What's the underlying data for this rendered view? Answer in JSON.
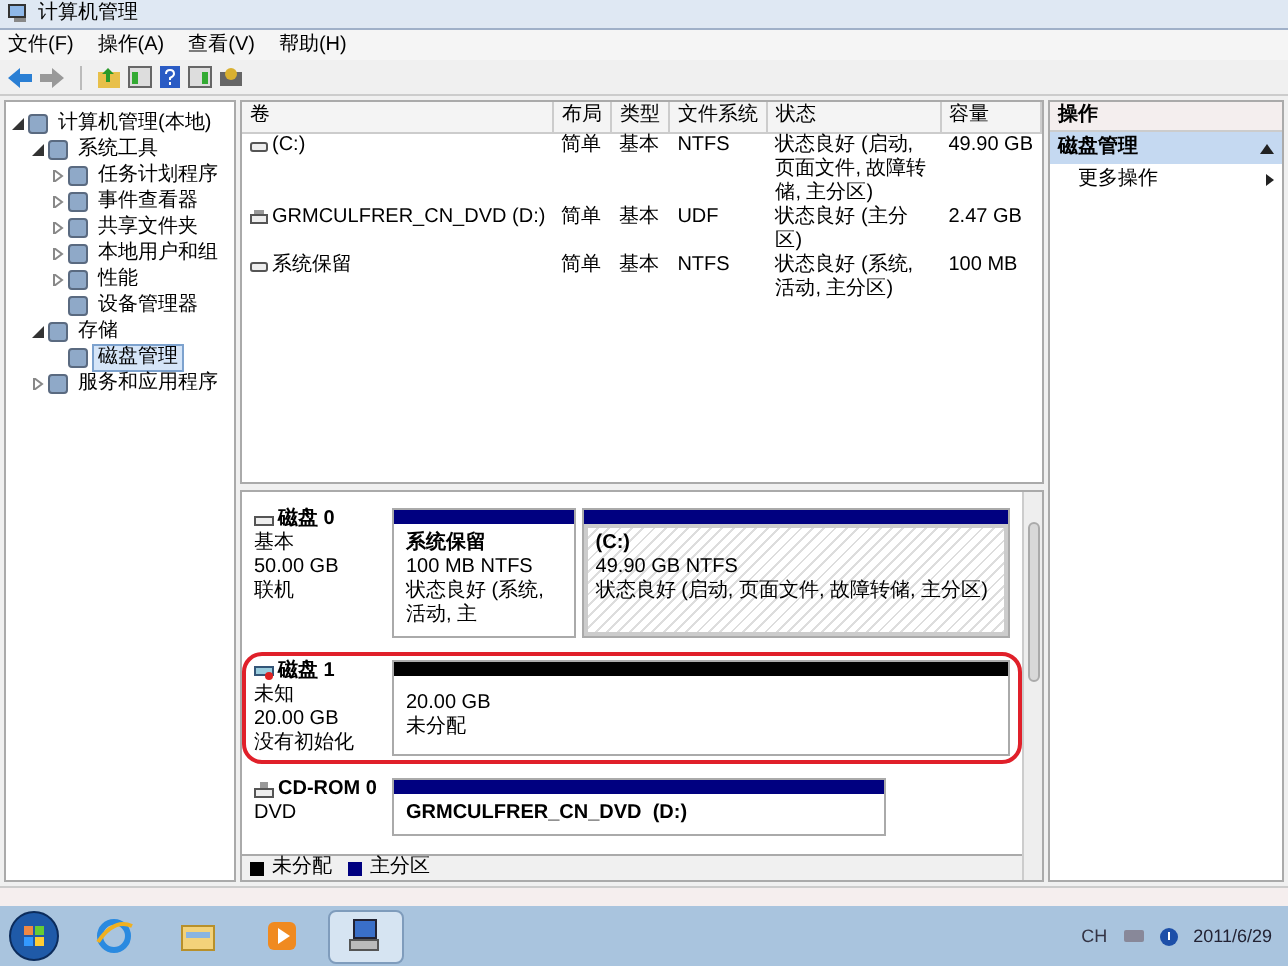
{
  "window": {
    "title": "计算机管理"
  },
  "menu": [
    "文件(F)",
    "操作(A)",
    "查看(V)",
    "帮助(H)"
  ],
  "tree": [
    {
      "label": "计算机管理(本地)",
      "selected": false,
      "expanded": true,
      "children": [
        {
          "label": "系统工具",
          "selected": false,
          "expanded": true,
          "children": [
            {
              "label": "任务计划程序",
              "selected": false,
              "expanded": false
            },
            {
              "label": "事件查看器",
              "selected": false,
              "expanded": false
            },
            {
              "label": "共享文件夹",
              "selected": false,
              "expanded": false
            },
            {
              "label": "本地用户和组",
              "selected": false,
              "expanded": false
            },
            {
              "label": "性能",
              "selected": false,
              "expanded": false
            },
            {
              "label": "设备管理器",
              "selected": false
            }
          ]
        },
        {
          "label": "存储",
          "selected": false,
          "expanded": true,
          "children": [
            {
              "label": "磁盘管理",
              "selected": true
            }
          ]
        },
        {
          "label": "服务和应用程序",
          "selected": false,
          "expanded": false
        }
      ]
    }
  ],
  "volumes": {
    "columns": [
      "卷",
      "布局",
      "类型",
      "文件系统",
      "状态",
      "容量"
    ],
    "rows": [
      {
        "kind": "disk",
        "cells": [
          "(C:)",
          "简单",
          "基本",
          "NTFS",
          "状态良好 (启动, 页面文件, 故障转储, 主分区)",
          "49.90 GB"
        ]
      },
      {
        "kind": "cdrom",
        "cells": [
          "GRMCULFRER_CN_DVD (D:)",
          "简单",
          "基本",
          "UDF",
          "状态良好 (主分区)",
          "2.47 GB"
        ]
      },
      {
        "kind": "disk",
        "cells": [
          "系统保留",
          "简单",
          "基本",
          "NTFS",
          "状态良好 (系统, 活动, 主分区)",
          "100 MB"
        ]
      }
    ]
  },
  "disks": [
    {
      "kind": "disk",
      "name": "磁盘 0",
      "lines": [
        "基本",
        "50.00 GB",
        "联机"
      ],
      "highlighted": false,
      "partitions": [
        {
          "kind": "primary",
          "selected": false,
          "title": "系统保留",
          "lines": [
            "100 MB NTFS",
            "状态良好 (系统, 活动, 主"
          ]
        },
        {
          "kind": "primary",
          "selected": true,
          "title": "(C:)",
          "lines": [
            "49.90 GB NTFS",
            "状态良好 (启动, 页面文件, 故障转储, 主分区)"
          ]
        }
      ]
    },
    {
      "kind": "unknown",
      "name": "磁盘 1",
      "lines": [
        "未知",
        "20.00 GB",
        "没有初始化"
      ],
      "highlighted": true,
      "partitions": [
        {
          "kind": "unallocated",
          "selected": false,
          "lines": [
            "20.00 GB",
            "未分配"
          ]
        }
      ]
    },
    {
      "kind": "cdrom",
      "name": "CD-ROM 0",
      "lines": [
        "DVD"
      ],
      "highlighted": false,
      "partitions": [
        {
          "kind": "primary",
          "selected": false,
          "title": "GRMCULFRER_CN_DVD  (D:)"
        }
      ]
    }
  ],
  "legend": [
    {
      "label": "未分配",
      "color": "#000000"
    },
    {
      "label": "主分区",
      "color": "#000080"
    }
  ],
  "actions": {
    "title": "操作",
    "section": "磁盘管理",
    "items": [
      "更多操作"
    ]
  },
  "taskbar": {
    "apps": [
      {
        "kind": "ie",
        "selected": false
      },
      {
        "kind": "explorer",
        "selected": false
      },
      {
        "kind": "media",
        "selected": false
      },
      {
        "kind": "mmc",
        "selected": true
      }
    ],
    "language": "CH",
    "date": "2011/6/29"
  }
}
